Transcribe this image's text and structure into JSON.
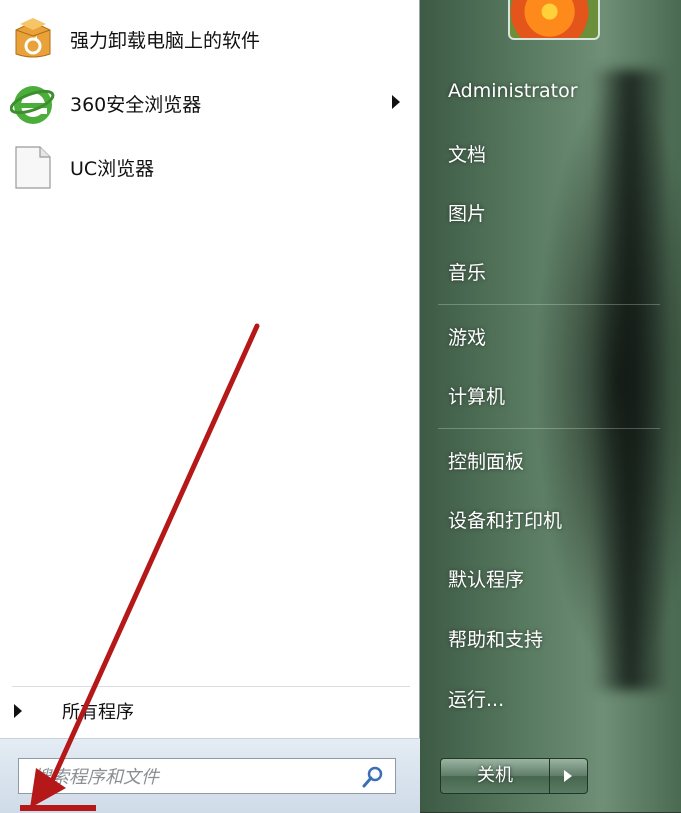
{
  "programs": [
    {
      "label": "强力卸载电脑上的软件",
      "icon": "uninstaller-box-icon"
    },
    {
      "label": "360安全浏览器",
      "icon": "browser-e-icon",
      "has_submenu": true
    },
    {
      "label": "UC浏览器",
      "icon": "blank-document-icon"
    }
  ],
  "all_programs": {
    "label": "所有程序"
  },
  "search": {
    "placeholder": "搜索程序和文件",
    "icon": "search-icon"
  },
  "user": {
    "name": "Administrator",
    "picture": "flower-user-picture"
  },
  "right_menu": {
    "documents": "文档",
    "pictures": "图片",
    "music": "音乐",
    "games": "游戏",
    "computer": "计算机",
    "control_panel": "控制面板",
    "devices_printers": "设备和打印机",
    "default_programs": "默认程序",
    "help_support": "帮助和支持",
    "run": "运行..."
  },
  "shutdown": {
    "label": "关机"
  },
  "colors": {
    "annotation_arrow": "#b51818",
    "glass_pane": "#587a60"
  }
}
